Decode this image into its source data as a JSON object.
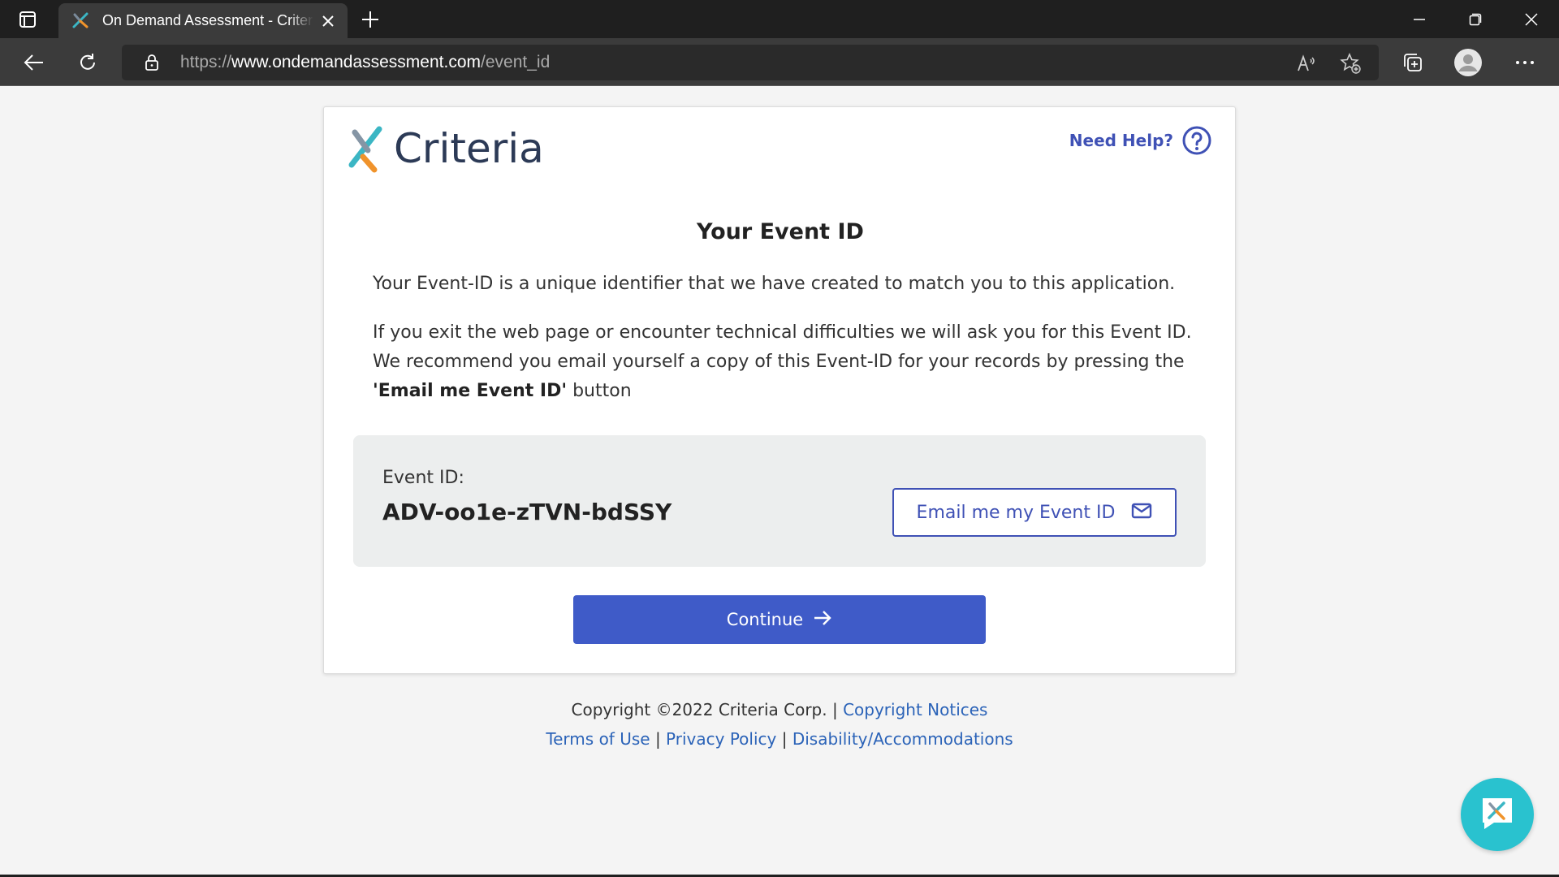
{
  "browser": {
    "tab_title": "On Demand Assessment - Criteria",
    "url_scheme": "https://",
    "url_host": "www.ondemandassessment.com",
    "url_path": "/event_id"
  },
  "header": {
    "logo_text": "Criteria",
    "help_label": "Need Help?"
  },
  "main": {
    "title": "Your Event ID",
    "paragraph1": "Your Event-ID is a unique identifier that we have created to match you to this application.",
    "paragraph2_pre": "If you exit the web page or encounter technical difficulties we will ask you for this Event ID. We recommend you email yourself a copy of this Event-ID for your records by pressing the ",
    "paragraph2_bold": "'Email me Event ID'",
    "paragraph2_post": " button",
    "event_id_label": "Event ID:",
    "event_id_value": "ADV-oo1e-zTVN-bdSSY",
    "email_button_label": "Email me my Event ID",
    "continue_button_label": "Continue"
  },
  "footer": {
    "copyright": "Copyright ©2022 Criteria Corp.",
    "sep": "|",
    "copyright_notices": "Copyright Notices",
    "terms": "Terms of Use",
    "privacy": "Privacy Policy",
    "disability": "Disability/Accommodations"
  },
  "colors": {
    "brand_blue": "#3f51b5",
    "continue_bg": "#3f5bc8",
    "link": "#2b63b8",
    "chat_bg": "#29c2cf",
    "logo_orange": "#f0932b",
    "logo_teal": "#3bb6c4"
  },
  "icons": {
    "tab_actions": "tab-actions-icon",
    "close": "close-icon",
    "new_tab": "plus-icon",
    "back": "back-arrow-icon",
    "refresh": "refresh-icon",
    "lock": "lock-icon",
    "read_aloud": "read-aloud-icon",
    "favorites": "add-favorite-icon",
    "collections": "collections-icon",
    "profile": "profile-icon",
    "menu": "more-icon",
    "help": "question-circle-icon",
    "mail": "envelope-icon",
    "arrow": "arrow-right-icon",
    "chat": "chat-icon"
  }
}
